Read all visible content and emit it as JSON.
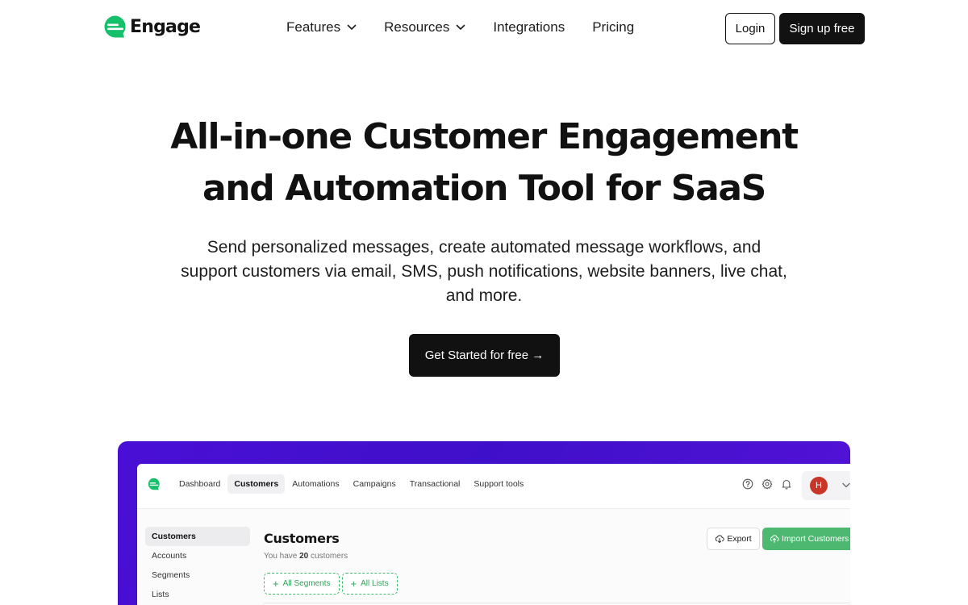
{
  "brand": {
    "name": "Engage",
    "accent": "#16c06a"
  },
  "nav": {
    "links": [
      {
        "label": "Features",
        "has_dropdown": true
      },
      {
        "label": "Resources",
        "has_dropdown": true
      },
      {
        "label": "Integrations",
        "has_dropdown": false
      },
      {
        "label": "Pricing",
        "has_dropdown": false
      }
    ],
    "login_label": "Login",
    "signup_label": "Sign up free"
  },
  "hero": {
    "title_line1": "All-in-one Customer Engagement",
    "title_line2": "and Automation Tool for SaaS",
    "subtitle_line1": "Send personalized messages, create automated message workflows, and",
    "subtitle_line2": "support customers via email, SMS, push notifications, website banners, live chat,",
    "subtitle_line3": "and more.",
    "cta_label": "Get Started for free →"
  },
  "preview": {
    "tabs": [
      {
        "label": "Dashboard",
        "active": false
      },
      {
        "label": "Customers",
        "active": true
      },
      {
        "label": "Automations",
        "active": false
      },
      {
        "label": "Campaigns",
        "active": false
      },
      {
        "label": "Transactional",
        "active": false
      },
      {
        "label": "Support tools",
        "active": false
      }
    ],
    "icons": [
      "help-circle-icon",
      "gear-icon",
      "bell-icon"
    ],
    "user_initial": "H",
    "avatar_color": "#c8362a",
    "sidebar": [
      {
        "label": "Customers",
        "active": true
      },
      {
        "label": "Accounts",
        "active": false
      },
      {
        "label": "Segments",
        "active": false
      },
      {
        "label": "Lists",
        "active": false
      }
    ],
    "page_title": "Customers",
    "count_prefix": "You have",
    "count": "20",
    "count_suffix": "customers",
    "export_label": "Export",
    "import_label": "Import Customers",
    "import_color": "#4db870",
    "chips": [
      {
        "label": "All Segments"
      },
      {
        "label": "All Lists"
      }
    ]
  }
}
